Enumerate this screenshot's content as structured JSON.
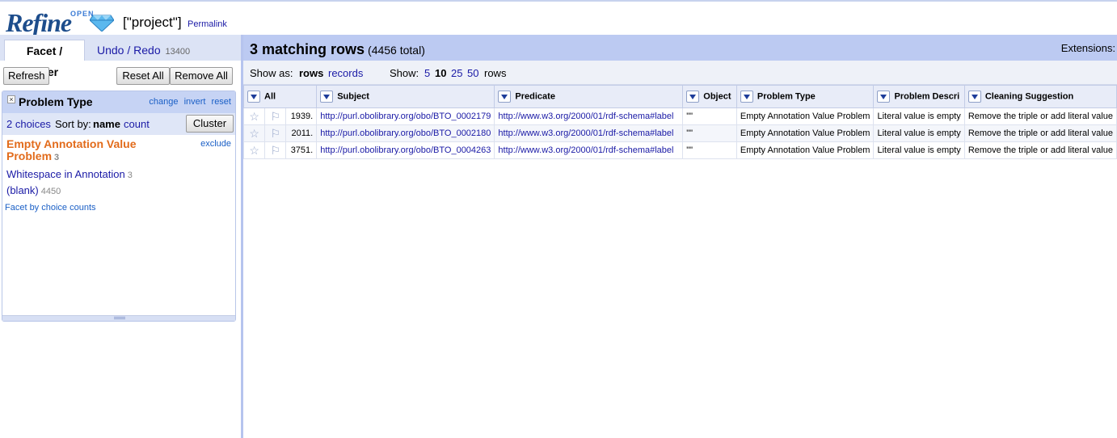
{
  "header": {
    "logo_text": "Refine",
    "logo_small": "OPEN",
    "project_name": "[\"project\"]",
    "permalink": "Permalink"
  },
  "left_panel": {
    "tabs": [
      {
        "label": "Facet / Filter"
      },
      {
        "label": "Undo / Redo",
        "count": "13400"
      }
    ],
    "refresh": "Refresh",
    "reset_all": "Reset All",
    "remove_all": "Remove All",
    "facet": {
      "close": "×",
      "title": "Problem Type",
      "actions": [
        "change",
        "invert",
        "reset"
      ],
      "choices_count": "2 choices",
      "sort_by": "Sort by:",
      "sort_name": "name",
      "sort_count": "count",
      "cluster": "Cluster",
      "choices": [
        {
          "label": "Empty Annotation Value Problem",
          "count": "3",
          "selected": true
        },
        {
          "label": "Whitespace in Annotation",
          "count": "3"
        },
        {
          "label": "(blank)",
          "count": "4450"
        }
      ],
      "exclude": "exclude",
      "facet_by_counts": "Facet by choice counts"
    }
  },
  "right_panel": {
    "matching": "3 matching rows",
    "total": "(4456 total)",
    "extensions": "Extensions:",
    "show_as": "Show as:",
    "rows": "rows",
    "records": "records",
    "show": "Show:",
    "page_sizes": [
      "5",
      "10",
      "25",
      "50"
    ],
    "rows_label": "rows",
    "columns": [
      "All",
      "Subject",
      "Predicate",
      "Object",
      "Problem Type",
      "Problem Descri",
      "Cleaning Suggestion"
    ],
    "data_rows": [
      {
        "num": "1939.",
        "subject": "http://purl.obolibrary.org/obo/BTO_0002179",
        "predicate": "http://www.w3.org/2000/01/rdf-schema#label",
        "object": "\"\"",
        "problem_type": "Empty Annotation Value Problem",
        "problem_desc": "Literal value is empty",
        "cleaning": "Remove the triple or add literal value"
      },
      {
        "num": "2011.",
        "subject": "http://purl.obolibrary.org/obo/BTO_0002180",
        "predicate": "http://www.w3.org/2000/01/rdf-schema#label",
        "object": "\"\"",
        "problem_type": "Empty Annotation Value Problem",
        "problem_desc": "Literal value is empty",
        "cleaning": "Remove the triple or add literal value"
      },
      {
        "num": "3751.",
        "subject": "http://purl.obolibrary.org/obo/BTO_0004263",
        "predicate": "http://www.w3.org/2000/01/rdf-schema#label",
        "object": "\"\"",
        "problem_type": "Empty Annotation Value Problem",
        "problem_desc": "Literal value is empty",
        "cleaning": "Remove the triple or add literal value"
      }
    ],
    "icons": {
      "star": "star-icon",
      "flag": "flag-icon",
      "dropdown": "dropdown-arrow-icon"
    }
  },
  "colors": {
    "brand": "#1d4d8c",
    "header_bar": "#bccaf2",
    "facet_title_bar": "#c6d3f4",
    "selected_choice": "#e26b1b",
    "link": "#1a1aa6"
  }
}
